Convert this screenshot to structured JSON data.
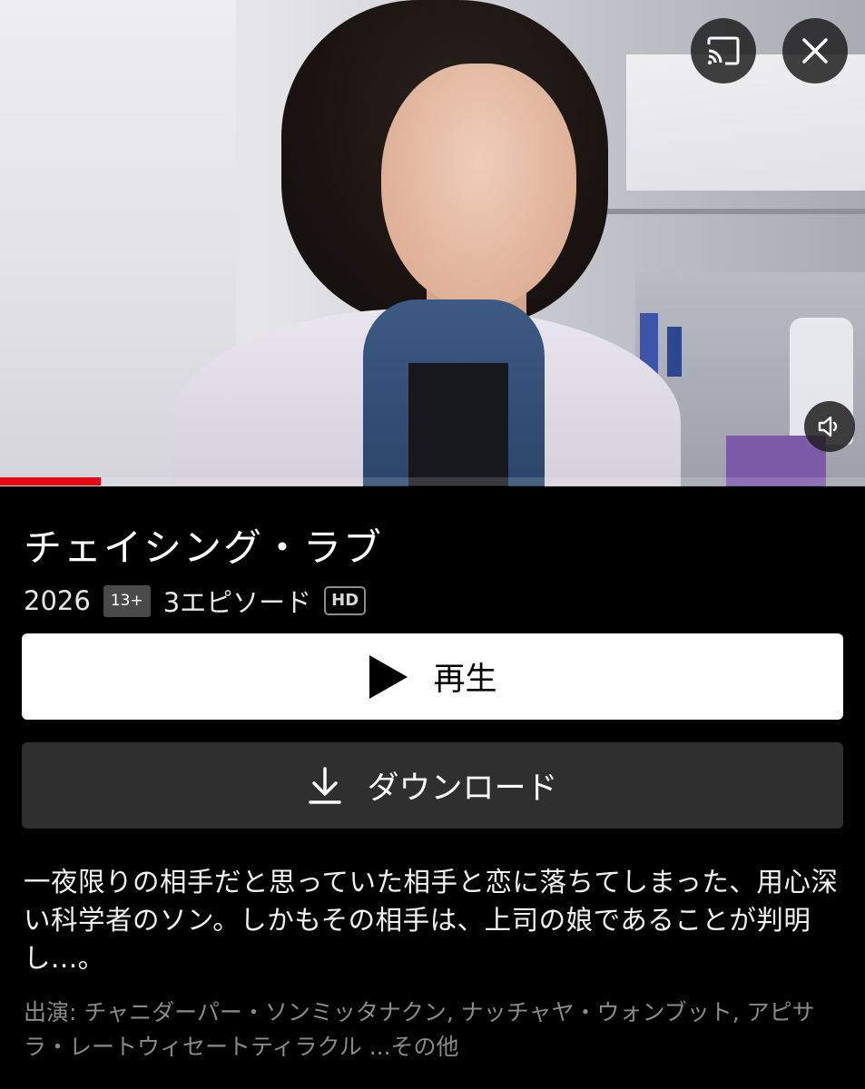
{
  "hero": {
    "progress_fraction": 0.116,
    "buttons": {
      "cast_icon": "cast-icon",
      "close_icon": "close-icon",
      "volume_icon": "volume-icon"
    }
  },
  "show": {
    "title": "チェイシング・ラブ",
    "year": "2026",
    "rating": "13+",
    "episodes": "3エピソード",
    "quality": "HD"
  },
  "actions": {
    "play_label": "再生",
    "play_icon": "play-icon",
    "download_label": "ダウンロード",
    "download_icon": "download-icon"
  },
  "synopsis": "一夜限りの相手だと思っていた相手と恋に落ちてしまった、用心深い科学者のソン。しかもその相手は、上司の娘であることが判明し...。",
  "cast": {
    "label": "出演: ",
    "names": "チャニダーパー・ソンミッタナクン, ナッチャヤ・ウォンブット, アピサラ・レートウィセートティラクル",
    "more": " ...その他"
  },
  "colors": {
    "accent": "#e50914",
    "background": "#000000",
    "secondary_button": "#2f2f2f",
    "muted_text": "#8a8a8a"
  }
}
